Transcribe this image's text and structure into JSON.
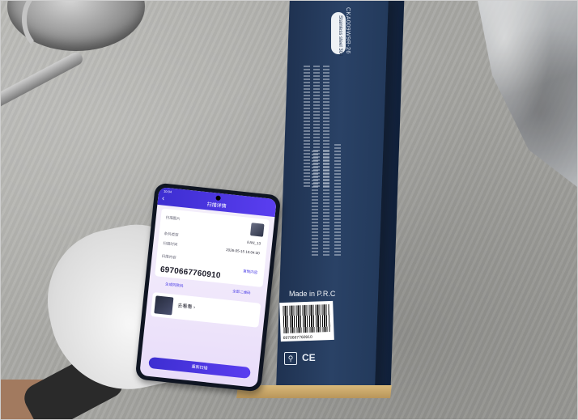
{
  "scene": {
    "description_tag": "photo of a smartphone barcode scan in front of a product box",
    "colors": {
      "box": "#24395c",
      "app_accent": "#4b3de6",
      "glove": "#efefef",
      "cloth": "#a9a9a5"
    }
  },
  "box": {
    "model": "CKA009W9R-26",
    "badge": "Stainless steel 304",
    "made_in": "Made in P.R.C",
    "barcode_digits": "6970667760910",
    "mark": "CE"
  },
  "phone_app": {
    "status_time": "10:04",
    "title": "扫描详情",
    "row1_label": "扫描图片",
    "row2_label": "条码类型",
    "row2_value": "EAN_13",
    "row3_label": "扫描时间",
    "row3_value": "2026-05-15 10:04:30",
    "row4_label": "扫描内容",
    "copy_label": "复制内容",
    "scanned_value": "6970667760910",
    "link_left": "生成同款码",
    "link_right": "全部二维码",
    "product_name": "去看看 ›",
    "button": "重新扫描"
  }
}
